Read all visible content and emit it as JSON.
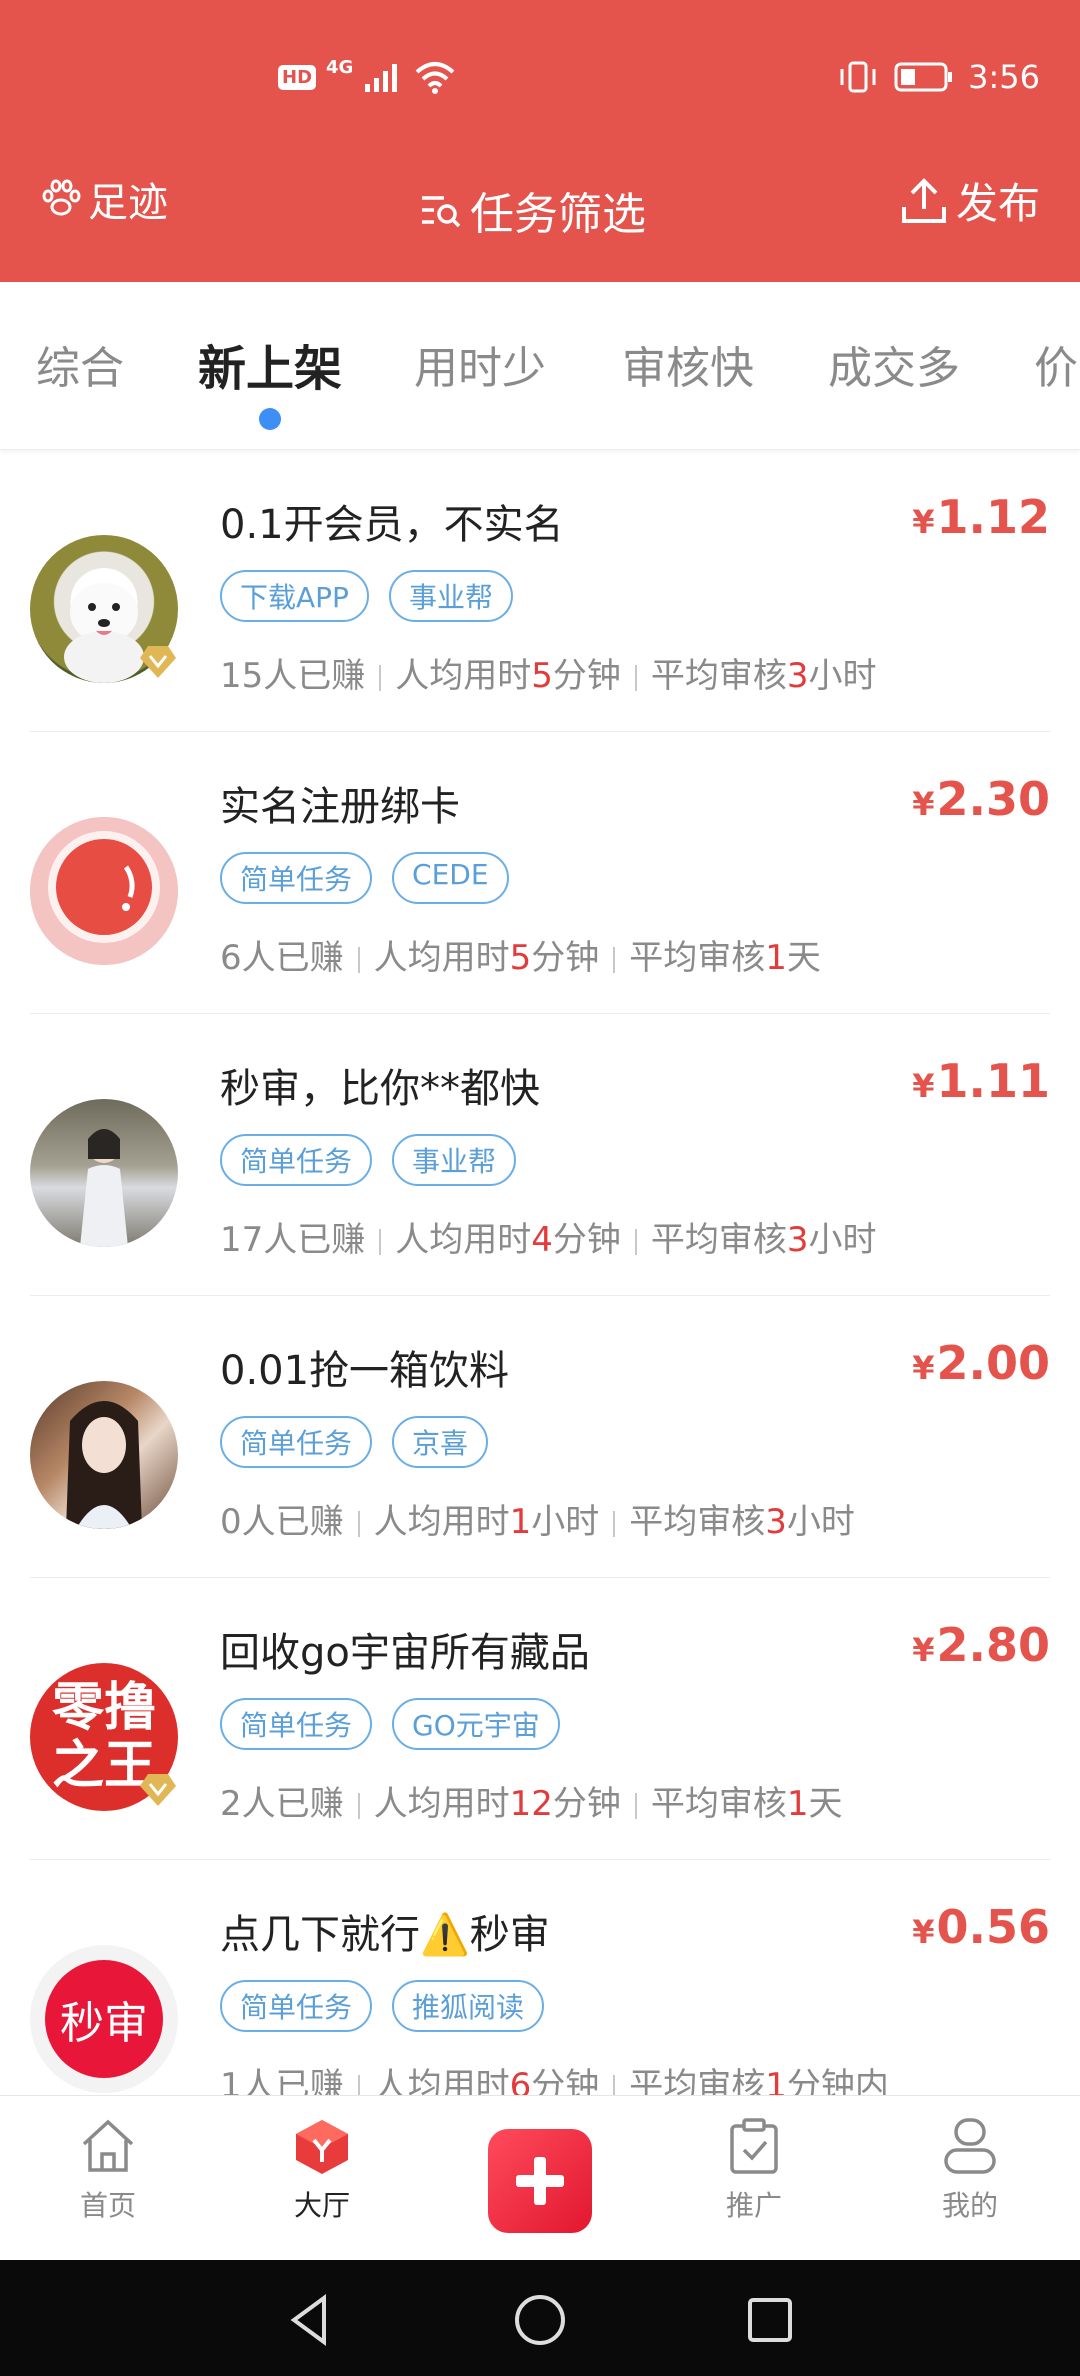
{
  "status_bar": {
    "time": "3:56",
    "hd": "HD",
    "network": "4G"
  },
  "header": {
    "footprint_label": "足迹",
    "filter_label": "任务筛选",
    "publish_label": "发布"
  },
  "tabs": [
    {
      "label": "综合"
    },
    {
      "label": "新上架"
    },
    {
      "label": "用时少"
    },
    {
      "label": "审核快"
    },
    {
      "label": "成交多"
    },
    {
      "label": "价"
    }
  ],
  "tasks": [
    {
      "title": "0.1开会员，不实名",
      "price": "1.12",
      "currency": "¥",
      "tags": [
        "下载APP",
        "事业帮"
      ],
      "earned_n": "15",
      "earned_suffix": "人已赚",
      "time_prefix": "人均用时",
      "time_n": "5",
      "time_unit": "分钟",
      "review_prefix": "平均审核",
      "review_n": "3",
      "review_unit": "小时"
    },
    {
      "title": "实名注册绑卡",
      "price": "2.30",
      "currency": "¥",
      "tags": [
        "简单任务",
        "CEDE"
      ],
      "earned_n": "6",
      "earned_suffix": "人已赚",
      "time_prefix": "人均用时",
      "time_n": "5",
      "time_unit": "分钟",
      "review_prefix": "平均审核",
      "review_n": "1",
      "review_unit": "天"
    },
    {
      "title": "秒审，比你**都快",
      "price": "1.11",
      "currency": "¥",
      "tags": [
        "简单任务",
        "事业帮"
      ],
      "earned_n": "17",
      "earned_suffix": "人已赚",
      "time_prefix": "人均用时",
      "time_n": "4",
      "time_unit": "分钟",
      "review_prefix": "平均审核",
      "review_n": "3",
      "review_unit": "小时"
    },
    {
      "title": "0.01抢一箱饮料",
      "price": "2.00",
      "currency": "¥",
      "tags": [
        "简单任务",
        "京喜"
      ],
      "earned_n": "0",
      "earned_suffix": "人已赚",
      "time_prefix": "人均用时",
      "time_n": "1",
      "time_unit": "小时",
      "review_prefix": "平均审核",
      "review_n": "3",
      "review_unit": "小时"
    },
    {
      "title": "回收go宇宙所有藏品",
      "price": "2.80",
      "currency": "¥",
      "tags": [
        "简单任务",
        "GO元宇宙"
      ],
      "earned_n": "2",
      "earned_suffix": "人已赚",
      "time_prefix": "人均用时",
      "time_n": "12",
      "time_unit": "分钟",
      "review_prefix": "平均审核",
      "review_n": "1",
      "review_unit": "天",
      "avatar_text": "零撸之王"
    },
    {
      "title": "点几下就行⚠️秒审",
      "price": "0.56",
      "currency": "¥",
      "tags": [
        "简单任务",
        "推狐阅读"
      ],
      "earned_n": "1",
      "earned_suffix": "人已赚",
      "time_prefix": "人均用时",
      "time_n": "6",
      "time_unit": "分钟",
      "review_prefix": "平均审核",
      "review_n": "1",
      "review_unit": "分钟内",
      "avatar_text": "秒审"
    }
  ],
  "bottom_nav": [
    {
      "label": "首页"
    },
    {
      "label": "大厅"
    },
    {
      "label": "推广"
    },
    {
      "label": "我的"
    }
  ],
  "colors": {
    "brand_red": "#e4544c",
    "tag_blue": "#5b9fd9",
    "tab_indicator": "#3d8ef5",
    "highlight_red": "#e23b3b"
  }
}
